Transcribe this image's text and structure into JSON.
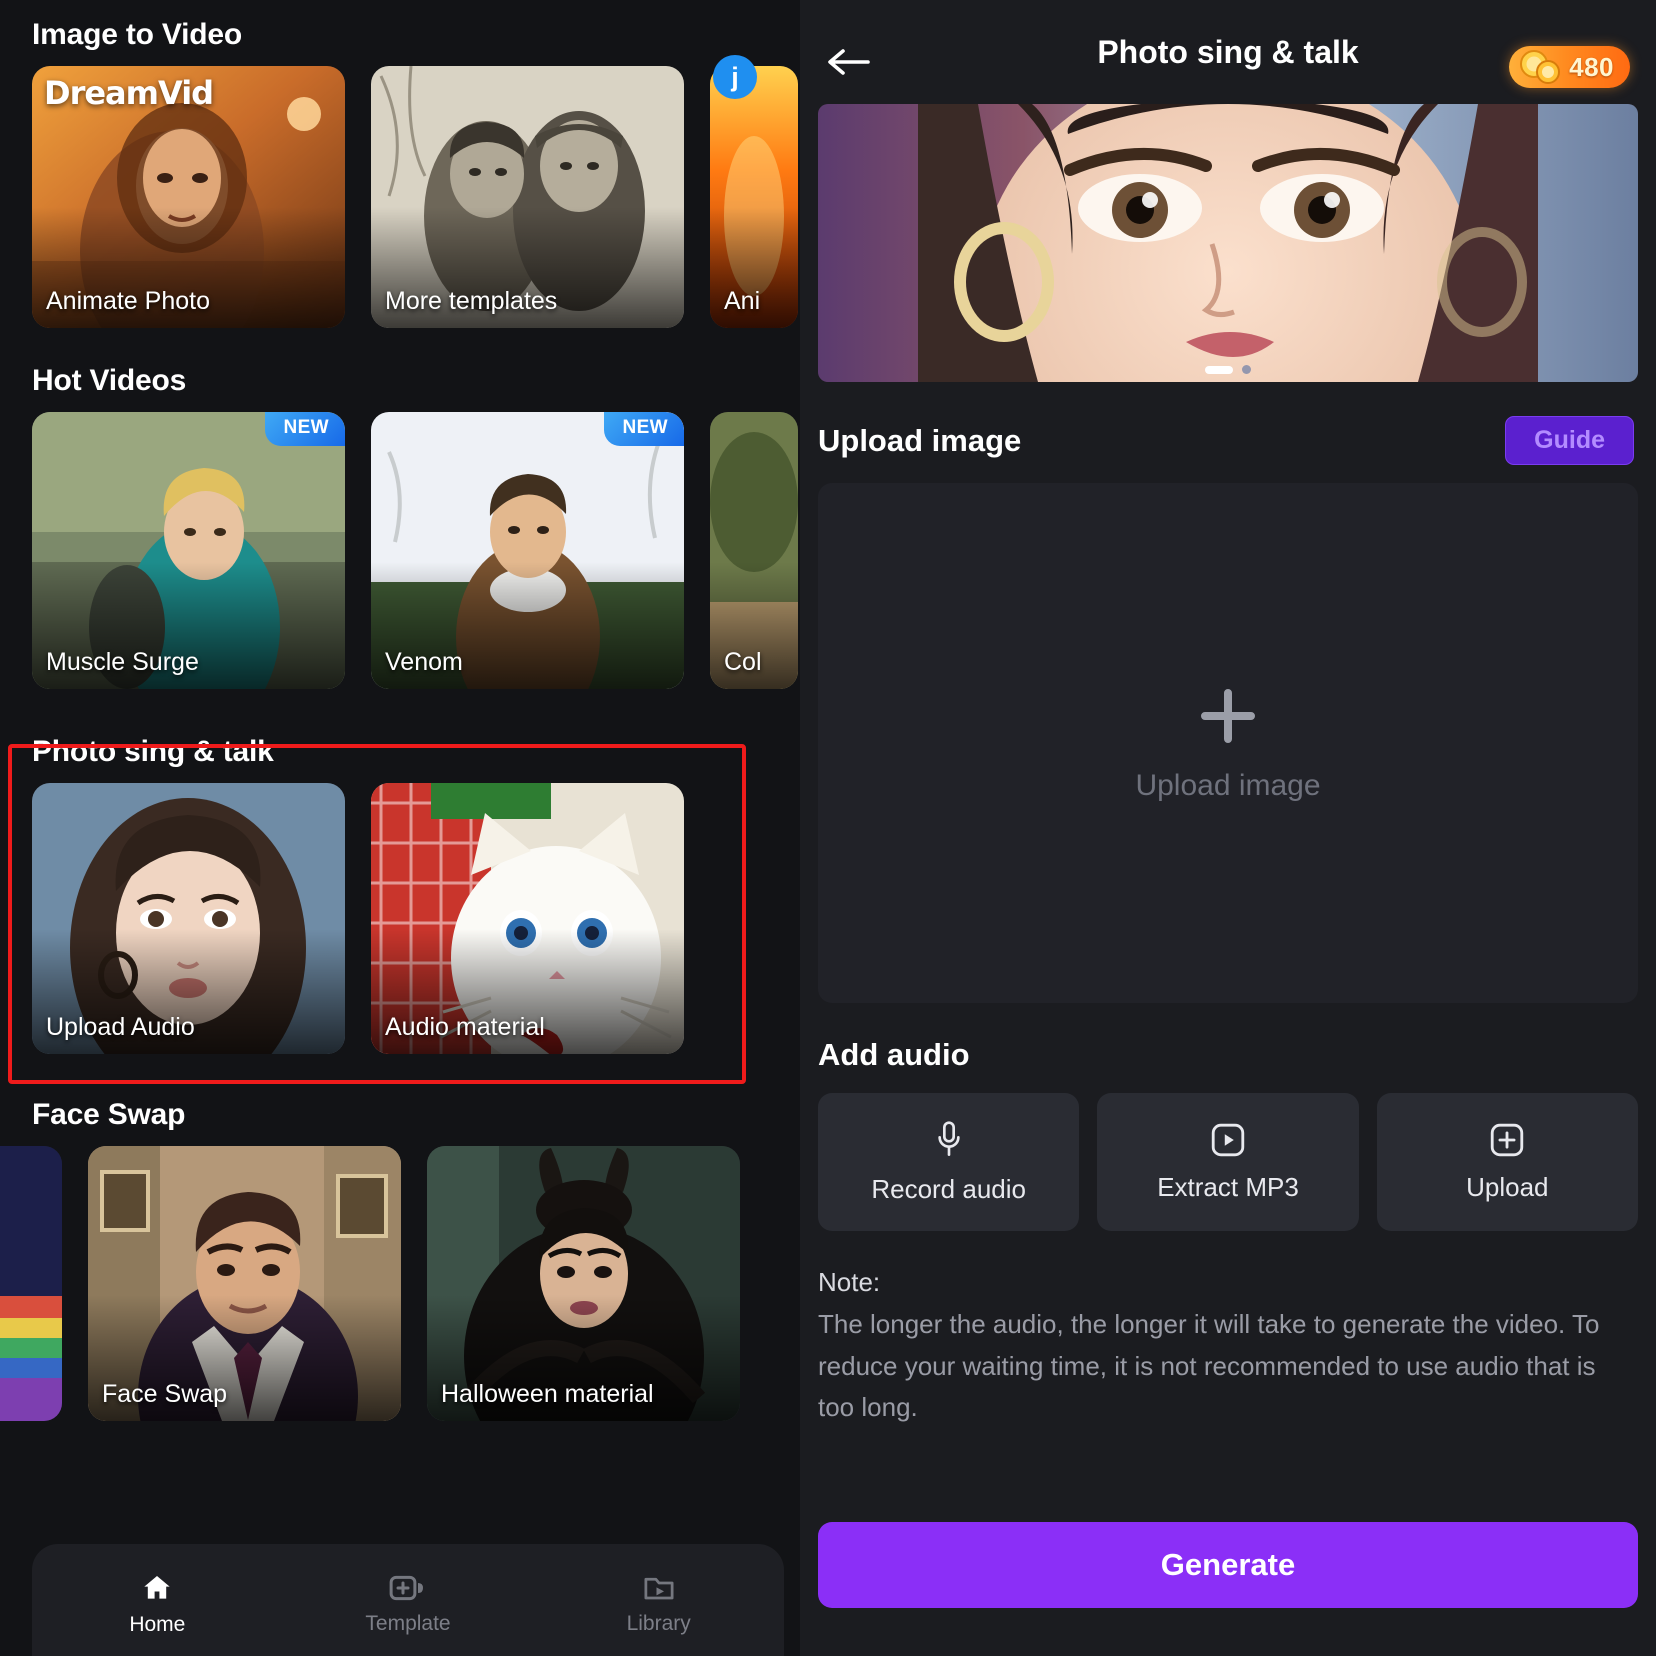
{
  "left_panel": {
    "sections": [
      {
        "title": "Image to Video",
        "cards": [
          {
            "label": "Animate Photo",
            "watermark": "DreamVid",
            "badge": null,
            "art": "woman-sunset"
          },
          {
            "label": "More templates",
            "watermark": null,
            "badge": null,
            "art": "elderly-couple-sepia"
          },
          {
            "label": "Ani",
            "watermark": null,
            "badge": null,
            "art": "fire-orange"
          }
        ]
      },
      {
        "title": "Hot Videos",
        "cards": [
          {
            "label": "Muscle Surge",
            "badge": "NEW",
            "art": "blonde-man-street"
          },
          {
            "label": "Venom",
            "badge": "NEW",
            "art": "man-brown-jacket"
          },
          {
            "label": "Col",
            "badge": null,
            "art": "autumn-park"
          }
        ]
      },
      {
        "title": "Photo sing & talk",
        "highlighted": true,
        "cards": [
          {
            "label": "Upload Audio",
            "badge": null,
            "art": "asian-woman-portrait"
          },
          {
            "label": "Audio material",
            "badge": null,
            "art": "white-cat"
          }
        ]
      },
      {
        "title": "Face Swap",
        "cards": [
          {
            "label": "",
            "badge": null,
            "art": "rainbow-edge"
          },
          {
            "label": "Face Swap",
            "badge": null,
            "art": "office-man-suit"
          },
          {
            "label": "Halloween material",
            "badge": null,
            "art": "dark-fairy-woman"
          }
        ]
      }
    ],
    "avatar_badge": "j",
    "bottom_nav": [
      {
        "label": "Home",
        "icon": "home-icon",
        "active": true
      },
      {
        "label": "Template",
        "icon": "video-plus-icon",
        "active": false
      },
      {
        "label": "Library",
        "icon": "library-folder-play-icon",
        "active": false
      }
    ]
  },
  "right_panel": {
    "back_icon": "back-arrow-icon",
    "title": "Photo sing & talk",
    "credits": {
      "amount": "480",
      "icon": "coin-icon"
    },
    "preview": {
      "art": "asian-woman-closeup",
      "pager": {
        "current": 1,
        "total": 2
      }
    },
    "upload_section": {
      "title": "Upload image",
      "guide_label": "Guide",
      "dropzone_label": "Upload image",
      "dropzone_icon": "plus-icon"
    },
    "audio_section": {
      "title": "Add audio",
      "buttons": [
        {
          "label": "Record audio",
          "icon": "microphone-icon"
        },
        {
          "label": "Extract MP3",
          "icon": "play-box-icon"
        },
        {
          "label": "Upload",
          "icon": "plus-box-icon"
        }
      ]
    },
    "note": {
      "heading": "Note:",
      "body": "The longer the audio, the longer it will take to generate the video. To reduce your waiting time, it is not recommended to use audio that is too long."
    },
    "generate_label": "Generate"
  },
  "colors": {
    "accent_purple": "#8b2ff7",
    "guide_purple": "#5b20cf",
    "badge_blue": "#1f8ff0",
    "highlight_red": "#ef1b1b",
    "credits_orange": "#ff8a1f",
    "bg_dark": "#121316",
    "panel_dark": "#1b1c20"
  }
}
